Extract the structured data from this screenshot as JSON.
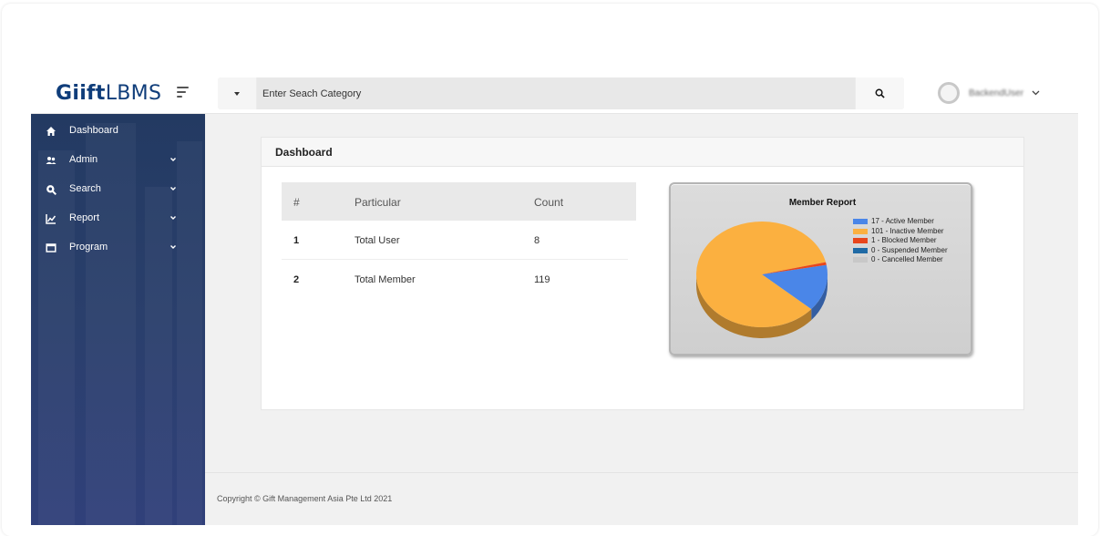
{
  "brand": {
    "logo_bold": "Giift",
    "logo_light": "LBMS"
  },
  "search": {
    "placeholder": "Enter Seach Category"
  },
  "user": {
    "name": "BackendUser"
  },
  "sidebar": {
    "items": [
      {
        "label": "Dashboard",
        "icon": "home-icon",
        "expandable": false
      },
      {
        "label": "Admin",
        "icon": "users-icon",
        "expandable": true
      },
      {
        "label": "Search",
        "icon": "search-globe-icon",
        "expandable": true
      },
      {
        "label": "Report",
        "icon": "chart-icon",
        "expandable": true
      },
      {
        "label": "Program",
        "icon": "window-icon",
        "expandable": true
      }
    ]
  },
  "panel": {
    "title": "Dashboard"
  },
  "table": {
    "headers": [
      "#",
      "Particular",
      "Count"
    ],
    "rows": [
      {
        "num": "1",
        "particular": "Total User",
        "count": "8"
      },
      {
        "num": "2",
        "particular": "Total Member",
        "count": "119"
      }
    ]
  },
  "chart_data": {
    "type": "pie",
    "title": "Member Report",
    "slices": [
      {
        "label": "17 - Active Member",
        "value": 17,
        "color": "#4a86e8"
      },
      {
        "label": "101 - Inactive Member",
        "value": 101,
        "color": "#fbb040"
      },
      {
        "label": "1 - Blocked Member",
        "value": 1,
        "color": "#e8461c"
      },
      {
        "label": "0 - Suspended Member",
        "value": 0,
        "color": "#1f6aa5"
      },
      {
        "label": "0 - Cancelled Member",
        "value": 0,
        "color": "#c8c8c8"
      }
    ],
    "legend": "top-right"
  },
  "footer": {
    "copyright": "Copyright © Gift Management Asia Pte Ltd 2021"
  },
  "colors": {
    "sidebar": "#2a3f6c",
    "brand": "#0f3d7a",
    "accent": "#4a86e8"
  }
}
